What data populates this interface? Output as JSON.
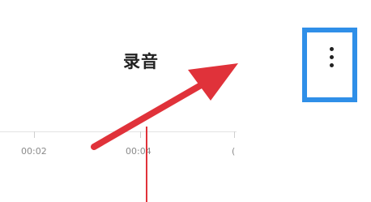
{
  "header": {
    "title": "录音",
    "more_icon": "more-vertical-icon"
  },
  "timeline": {
    "tick_labels": [
      "00:02",
      "00:04",
      "("
    ]
  },
  "colors": {
    "highlight_box": "#2f8fe8",
    "annotation_arrow": "#e0323a",
    "playhead": "#e0323a"
  }
}
